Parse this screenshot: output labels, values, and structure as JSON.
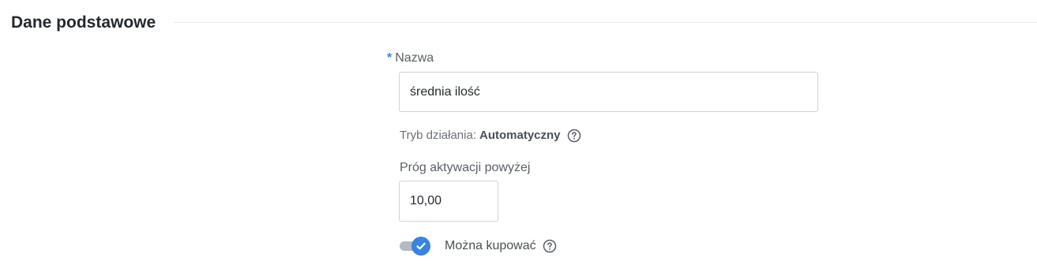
{
  "section": {
    "title": "Dane podstawowe"
  },
  "name_field": {
    "required_mark": "*",
    "label": "Nazwa",
    "value": "średnia ilość"
  },
  "mode": {
    "label": "Tryb działania:",
    "value": "Automatyczny",
    "help_icon": "question-circle-icon"
  },
  "threshold_field": {
    "label": "Próg aktywacji powyżej",
    "value": "10,00"
  },
  "can_buy": {
    "label": "Można kupować",
    "enabled": true,
    "help_icon": "question-circle-icon"
  },
  "colors": {
    "accent": "#3b84dd",
    "toggle_track": "#b4bac3",
    "border": "#cfd3d8"
  }
}
